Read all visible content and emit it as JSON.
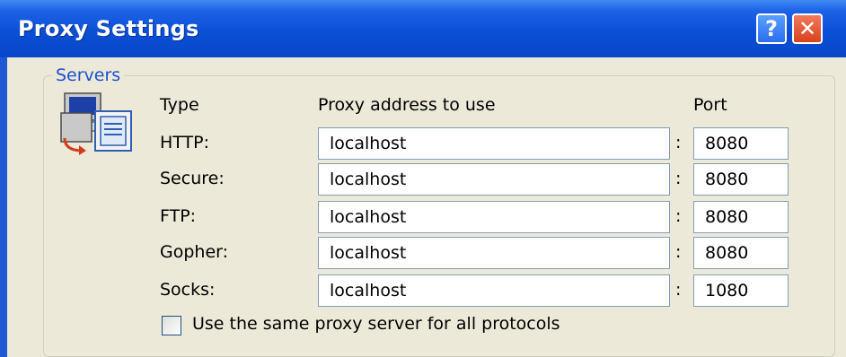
{
  "window": {
    "title": "Proxy Settings",
    "help_icon": "?",
    "close_icon": "✕"
  },
  "servers": {
    "group_label": "Servers",
    "icon": "network-computers-icon",
    "headers": {
      "type": "Type",
      "address": "Proxy address to use",
      "port": "Port"
    },
    "rows": [
      {
        "label": "HTTP:",
        "address": "localhost",
        "port": "8080"
      },
      {
        "label": "Secure:",
        "address": "localhost",
        "port": "8080"
      },
      {
        "label": "FTP:",
        "address": "localhost",
        "port": "8080"
      },
      {
        "label": "Gopher:",
        "address": "localhost",
        "port": "8080"
      },
      {
        "label": "Socks:",
        "address": "localhost",
        "port": "1080"
      }
    ],
    "separator": ":",
    "same_proxy": {
      "label": "Use the same proxy server for all protocols",
      "checked": false
    }
  },
  "colors": {
    "titlebar": "#0a4fd6",
    "client_bg": "#ece9d8",
    "group_label": "#1d4fd0",
    "close_button": "#d8431d",
    "help_button": "#2a6ef0"
  }
}
